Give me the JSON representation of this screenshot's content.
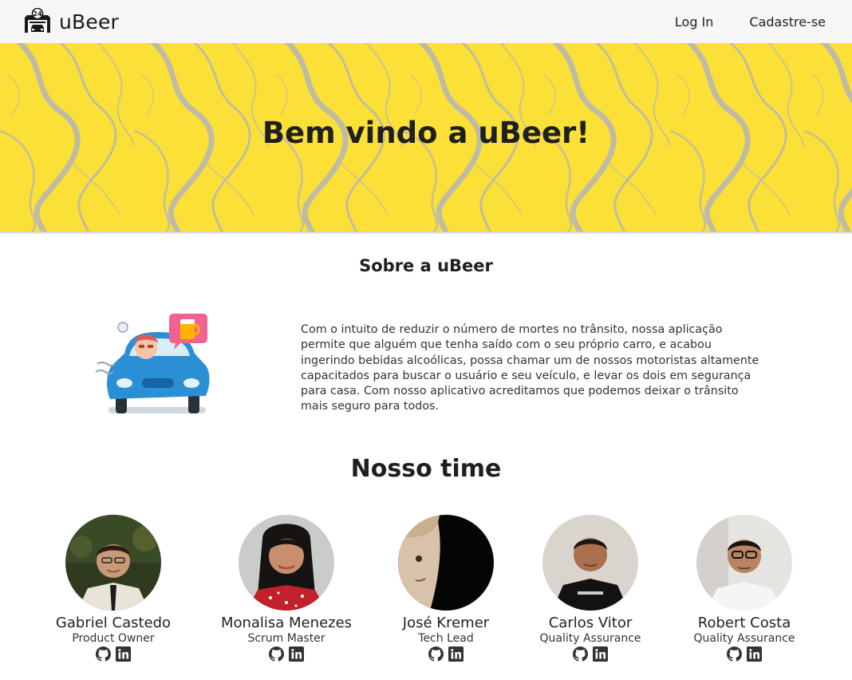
{
  "navbar": {
    "brand": "uBeer",
    "logo_icon": "garage-car-24h-icon",
    "links": [
      "Log In",
      "Cadastre-se"
    ]
  },
  "hero": {
    "title": "Bem vindo a uBeer!",
    "background_color": "#fbe038",
    "marble_color": "#b9b7b2"
  },
  "about": {
    "title": "Sobre a uBeer",
    "illustration": "drunk-driver-car-beer-icon",
    "text": "Com o intuito de reduzir o número de mortes no trânsito, nossa aplicação permite que alguém que tenha saído com o seu próprio carro, e acabou ingerindo bebidas alcoólicas, possa chamar um de nossos motoristas altamente capacitados para buscar o usuário e seu veículo, e levar os dois em segurança para casa. Com nosso aplicativo acreditamos que podemos deixar o trânsito mais seguro para todos."
  },
  "team": {
    "title": "Nosso time",
    "members": [
      {
        "name": "Gabriel Castedo",
        "role": "Product Owner"
      },
      {
        "name": "Monalisa Menezes",
        "role": "Scrum Master"
      },
      {
        "name": "José Kremer",
        "role": "Tech Lead"
      },
      {
        "name": "Carlos Vitor",
        "role": "Quality Assurance"
      },
      {
        "name": "Robert Costa",
        "role": "Quality Assurance"
      }
    ],
    "social_icons": [
      "github-icon",
      "linkedin-icon"
    ]
  }
}
